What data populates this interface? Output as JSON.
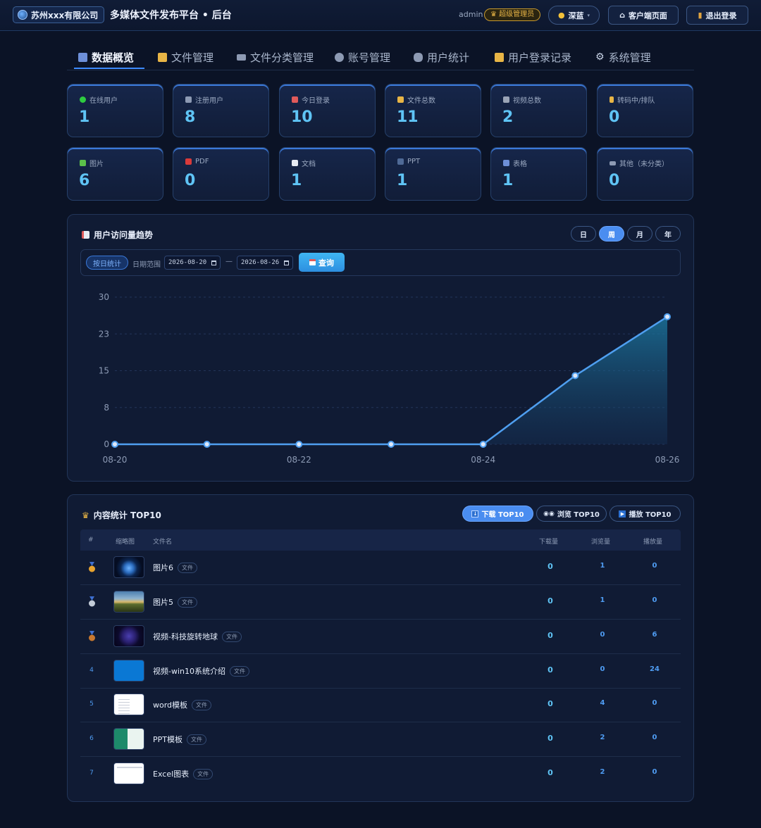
{
  "header": {
    "company": "苏州xxx有限公司",
    "title": "多媒体文件发布平台 • 后台",
    "user": "admin",
    "role": "超级管理员",
    "theme_label": "深蓝",
    "client_btn": "客户端页面",
    "logout_btn": "退出登录"
  },
  "tabs": [
    {
      "label": "数据概览",
      "icon": "bar-chart-icon"
    },
    {
      "label": "文件管理",
      "icon": "folder-icon"
    },
    {
      "label": "文件分类管理",
      "icon": "tags-icon"
    },
    {
      "label": "账号管理",
      "icon": "user-icon"
    },
    {
      "label": "用户统计",
      "icon": "users-icon"
    },
    {
      "label": "用户登录记录",
      "icon": "lock-icon"
    },
    {
      "label": "系统管理",
      "icon": "gear-icon"
    }
  ],
  "stats_row1": [
    {
      "label": "在线用户",
      "value": "1",
      "icon": "online-dot-icon"
    },
    {
      "label": "注册用户",
      "value": "8",
      "icon": "user-card-icon"
    },
    {
      "label": "今日登录",
      "value": "10",
      "icon": "calendar-icon"
    },
    {
      "label": "文件总数",
      "value": "11",
      "icon": "folder-icon"
    },
    {
      "label": "视频总数",
      "value": "2",
      "icon": "clapper-icon"
    },
    {
      "label": "转码中/排队",
      "value": "0",
      "icon": "hourglass-icon"
    }
  ],
  "stats_row2": [
    {
      "label": "图片",
      "value": "6",
      "icon": "image-icon"
    },
    {
      "label": "PDF",
      "value": "0",
      "icon": "pdf-icon"
    },
    {
      "label": "文档",
      "value": "1",
      "icon": "document-icon"
    },
    {
      "label": "PPT",
      "value": "1",
      "icon": "ppt-icon"
    },
    {
      "label": "表格",
      "value": "1",
      "icon": "sheet-icon"
    },
    {
      "label": "其他（未分类）",
      "value": "0",
      "icon": "other-icon"
    }
  ],
  "trend": {
    "title": "用户访问量趋势",
    "ranges": [
      "日",
      "周",
      "月",
      "年"
    ],
    "active_range": "周",
    "mode_label": "按日统计",
    "date_range_label": "日期范围",
    "date_from": "2026-08-20",
    "date_to": "2026-08-26",
    "dash": "—",
    "query_btn": "查询"
  },
  "chart_data": {
    "type": "area",
    "x": [
      "08-20",
      "08-21",
      "08-22",
      "08-23",
      "08-24",
      "08-25",
      "08-26"
    ],
    "x_tick_labels": [
      "08-20",
      "08-22",
      "08-24",
      "08-26"
    ],
    "y_ticks": [
      "0",
      "8",
      "15",
      "23",
      "30"
    ],
    "series": [
      {
        "values": [
          0,
          0,
          0,
          0,
          0,
          14,
          26
        ]
      }
    ],
    "ylim": [
      0,
      30
    ],
    "grid": true,
    "colors": {
      "line": "#4f9ff0",
      "fill": "#1d6f9a"
    }
  },
  "top10": {
    "title": "内容统计 TOP10",
    "buttons": [
      "下载 TOP10",
      "浏览 TOP10",
      "播放 TOP10"
    ],
    "active": "下载 TOP10",
    "columns": [
      "#",
      "缩略图",
      "文件名",
      "下载量",
      "浏览量",
      "播放量"
    ],
    "tag_label": "文件",
    "rows": [
      {
        "rank": "1",
        "medal": "gold",
        "name": "图片6",
        "downloads": "0",
        "views": "1",
        "plays": "0",
        "thumb": "earth"
      },
      {
        "rank": "2",
        "medal": "silver",
        "name": "图片5",
        "downloads": "0",
        "views": "1",
        "plays": "0",
        "thumb": "landscape"
      },
      {
        "rank": "3",
        "medal": "bronze",
        "name": "视频-科技旋转地球",
        "downloads": "0",
        "views": "0",
        "plays": "6",
        "thumb": "globe"
      },
      {
        "rank": "4",
        "medal": "",
        "name": "视频-win10系统介绍",
        "downloads": "0",
        "views": "0",
        "plays": "24",
        "thumb": "blue"
      },
      {
        "rank": "5",
        "medal": "",
        "name": "word模板",
        "downloads": "0",
        "views": "4",
        "plays": "0",
        "thumb": "doc"
      },
      {
        "rank": "6",
        "medal": "",
        "name": "PPT模板",
        "downloads": "0",
        "views": "2",
        "plays": "0",
        "thumb": "ppt"
      },
      {
        "rank": "7",
        "medal": "",
        "name": "Excel图表",
        "downloads": "0",
        "views": "2",
        "plays": "0",
        "thumb": "xls"
      }
    ]
  }
}
